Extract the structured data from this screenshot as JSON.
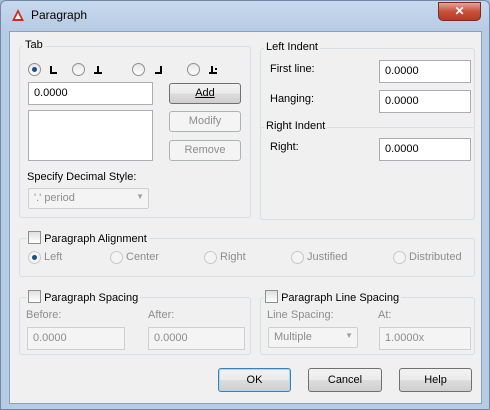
{
  "window": {
    "title": "Paragraph",
    "close_label": "✕"
  },
  "tab": {
    "group_label": "Tab",
    "tab_value": "0.0000",
    "add_label": "Add",
    "modify_label": "Modify",
    "remove_label": "Remove",
    "decimal_style_label": "Specify Decimal Style:",
    "decimal_style_value": "'.' period",
    "tab_types": [
      "left-tab-icon",
      "center-tab-icon",
      "right-tab-icon",
      "decimal-tab-icon"
    ],
    "selected_tab_type": "left"
  },
  "left_indent": {
    "group_label": "Left Indent",
    "first_line_label": "First line:",
    "first_line_value": "0.0000",
    "hanging_label": "Hanging:",
    "hanging_value": "0.0000"
  },
  "right_indent": {
    "group_label": "Right Indent",
    "right_label": "Right:",
    "right_value": "0.0000"
  },
  "paragraph_alignment": {
    "label": "Paragraph Alignment",
    "checked": false,
    "options": [
      "Left",
      "Center",
      "Right",
      "Justified",
      "Distributed"
    ],
    "selected": "Left"
  },
  "paragraph_spacing": {
    "label": "Paragraph Spacing",
    "checked": false,
    "before_label": "Before:",
    "before_value": "0.0000",
    "after_label": "After:",
    "after_value": "0.0000"
  },
  "line_spacing": {
    "label": "Paragraph Line Spacing",
    "checked": false,
    "line_spacing_label": "Line Spacing:",
    "line_spacing_value": "Multiple",
    "at_label": "At:",
    "at_value": "1.0000x"
  },
  "buttons": {
    "ok": "OK",
    "cancel": "Cancel",
    "help": "Help"
  },
  "colors": {
    "title_bar": "#b7cbe4",
    "close_button": "#c7503a",
    "dialog_background": "#f0f0f0",
    "selected_radio": "#1a4f8a"
  }
}
